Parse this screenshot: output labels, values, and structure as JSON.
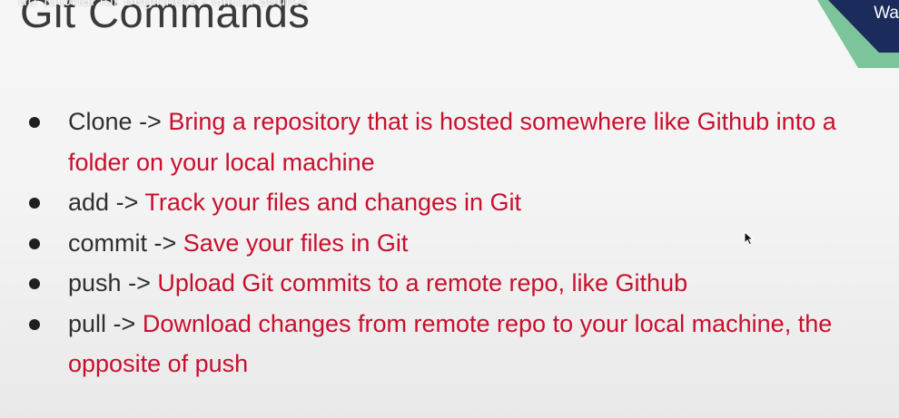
{
  "video": {
    "title_overlay": "ub Tutorial for Beginners - Glitch Source"
  },
  "slide": {
    "title": "Git Commands",
    "corner_logo_text": "Wa",
    "colors": {
      "description": "#c8102e",
      "command": "#2f2f2f",
      "background": "#f3f3f3",
      "accent_dark_blue": "#1b2b5c",
      "accent_green": "#7cc49a"
    },
    "bullets": [
      {
        "command": "Clone",
        "arrow": "->",
        "description": "Bring a repository that is hosted somewhere like Github into a folder on your local machine"
      },
      {
        "command": "add",
        "arrow": "->",
        "description": "Track your files and changes in Git"
      },
      {
        "command": "commit",
        "arrow": "->",
        "description": "Save your files in Git"
      },
      {
        "command": "push",
        "arrow": "->",
        "description": "Upload Git commits to a remote repo, like Github"
      },
      {
        "command": "pull",
        "arrow": "->",
        "description": "Download changes from remote repo to your local machine, the opposite of push"
      }
    ]
  },
  "icons": {
    "bullet": "bullet-dot-icon",
    "cursor": "mouse-pointer-icon"
  }
}
